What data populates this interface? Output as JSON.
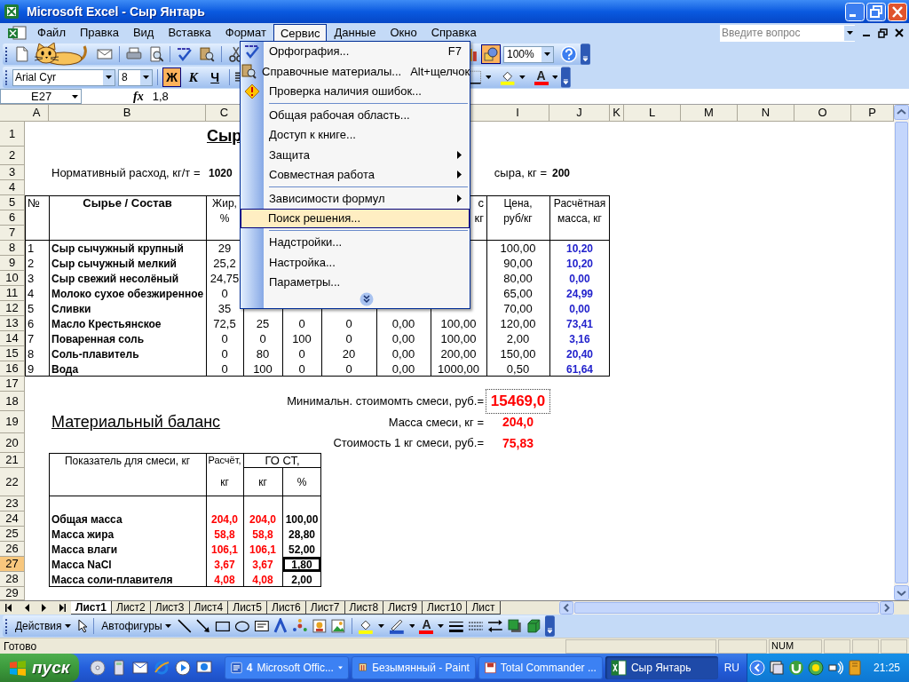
{
  "window": {
    "title": "Microsoft Excel - Сыр Янтарь"
  },
  "menu_bar": {
    "items": [
      {
        "label": "Файл",
        "selected": false
      },
      {
        "label": "Правка",
        "selected": false
      },
      {
        "label": "Вид",
        "selected": false
      },
      {
        "label": "Вставка",
        "selected": false
      },
      {
        "label": "Формат",
        "selected": false
      },
      {
        "label": "Сервис",
        "selected": true
      },
      {
        "label": "Данные",
        "selected": false
      },
      {
        "label": "Окно",
        "selected": false
      },
      {
        "label": "Справка",
        "selected": false
      }
    ],
    "help_placeholder": "Введите вопрос"
  },
  "standard_toolbar": {
    "zoom": "100%",
    "drawing_toggle": true
  },
  "formatting_toolbar": {
    "font": "Arial Cyr",
    "size": "8",
    "styles": [
      {
        "label": "Ж",
        "on": true
      },
      {
        "label": "К",
        "on": false
      },
      {
        "label": "Ч",
        "on": false
      }
    ],
    "font_color": "A"
  },
  "formula_bar": {
    "name_box": "E27",
    "function_label": "fx",
    "formula": "1,8"
  },
  "sheet": {
    "columns": [
      {
        "label": "A"
      },
      {
        "label": "B"
      },
      {
        "label": "C"
      },
      {
        "label": "I"
      },
      {
        "label": "J"
      },
      {
        "label": "K"
      },
      {
        "label": "L"
      },
      {
        "label": "M"
      },
      {
        "label": "N"
      },
      {
        "label": "O"
      },
      {
        "label": "P"
      }
    ],
    "rows": [
      {
        "number": "1",
        "selected": false,
        "cells": {
          "C": {
            "kind": "title",
            "text": "Сыр"
          }
        }
      },
      {
        "number": "2",
        "selected": false
      },
      {
        "number": "3",
        "selected": false,
        "cells": {
          "B": {
            "kind": "label",
            "text": "Нормативный расход, кг/т ="
          },
          "C": {
            "kind": "bold",
            "text": "1020"
          },
          "I": {
            "kind": "label-right",
            "text": "сыра, кг ="
          },
          "J": {
            "kind": "bold",
            "text": "200"
          }
        }
      },
      {
        "number": "4",
        "selected": false
      },
      {
        "number": "5",
        "selected": false,
        "cells": {
          "A": {
            "kind": "label",
            "text": "№"
          },
          "B": {
            "kind": "header-bold",
            "text": "Сырье / Состав"
          },
          "C": {
            "kind": "header",
            "text": "Жир,"
          },
          "H": {
            "kind": "label-right",
            "text": "с"
          },
          "I": {
            "kind": "header",
            "text": "Цена,"
          },
          "J": {
            "kind": "header",
            "text": "Расчётная"
          }
        }
      },
      {
        "number": "6",
        "selected": false,
        "cells": {
          "C": {
            "kind": "header",
            "text": "%"
          },
          "H": {
            "kind": "label-right",
            "text": "кг"
          },
          "I": {
            "kind": "header",
            "text": "руб/кг"
          },
          "J": {
            "kind": "header",
            "text": "масса, кг"
          }
        }
      },
      {
        "number": "7",
        "selected": false
      },
      {
        "number": "8",
        "selected": false,
        "cells": {
          "A": {
            "kind": "label",
            "text": "1"
          },
          "B": {
            "kind": "bold",
            "text": "Сыр сычужный крупный"
          },
          "C": {
            "kind": "number",
            "text": "29"
          },
          "I": {
            "kind": "number",
            "text": "100,00"
          },
          "J": {
            "kind": "blue",
            "text": "10,20"
          }
        }
      },
      {
        "number": "9",
        "selected": false,
        "cells": {
          "A": {
            "kind": "label",
            "text": "2"
          },
          "B": {
            "kind": "bold",
            "text": "Сыр сычужный мелкий"
          },
          "C": {
            "kind": "number",
            "text": "25,2"
          },
          "I": {
            "kind": "number",
            "text": "90,00"
          },
          "J": {
            "kind": "blue",
            "text": "10,20"
          }
        }
      },
      {
        "number": "10",
        "selected": false,
        "cells": {
          "A": {
            "kind": "label",
            "text": "3"
          },
          "B": {
            "kind": "bold",
            "text": "Сыр свежий несолёный"
          },
          "C": {
            "kind": "number",
            "text": "24,75"
          },
          "I": {
            "kind": "number",
            "text": "80,00"
          },
          "J": {
            "kind": "blue",
            "text": "0,00"
          }
        }
      },
      {
        "number": "11",
        "selected": false,
        "cells": {
          "A": {
            "kind": "label",
            "text": "4"
          },
          "B": {
            "kind": "bold",
            "text": "Молоко сухое обезжиренное"
          },
          "C": {
            "kind": "number",
            "text": "0"
          },
          "I": {
            "kind": "number",
            "text": "65,00"
          },
          "J": {
            "kind": "blue",
            "text": "24,99"
          }
        }
      },
      {
        "number": "12",
        "selected": false,
        "cells": {
          "A": {
            "kind": "label",
            "text": "5"
          },
          "B": {
            "kind": "bold",
            "text": "Сливки"
          },
          "C": {
            "kind": "number",
            "text": "35"
          },
          "I": {
            "kind": "number",
            "text": "70,00"
          },
          "J": {
            "kind": "blue",
            "text": "0,00"
          }
        }
      },
      {
        "number": "13",
        "selected": false,
        "cells": {
          "A": {
            "kind": "label",
            "text": "6"
          },
          "B": {
            "kind": "bold",
            "text": "Масло Крестьянское"
          },
          "C": {
            "kind": "number",
            "text": "72,5"
          },
          "D": {
            "kind": "number",
            "text": "25"
          },
          "E": {
            "kind": "number",
            "text": "0"
          },
          "F": {
            "kind": "number",
            "text": "0"
          },
          "G": {
            "kind": "number",
            "text": "0,00"
          },
          "H": {
            "kind": "number",
            "text": "100,00"
          },
          "I": {
            "kind": "number",
            "text": "120,00"
          },
          "J": {
            "kind": "blue",
            "text": "73,41"
          }
        }
      },
      {
        "number": "14",
        "selected": false,
        "cells": {
          "A": {
            "kind": "label",
            "text": "7"
          },
          "B": {
            "kind": "bold",
            "text": "Поваренная соль"
          },
          "C": {
            "kind": "number",
            "text": "0"
          },
          "D": {
            "kind": "number",
            "text": "0"
          },
          "E": {
            "kind": "number",
            "text": "100"
          },
          "F": {
            "kind": "number",
            "text": "0"
          },
          "G": {
            "kind": "number",
            "text": "0,00"
          },
          "H": {
            "kind": "number",
            "text": "100,00"
          },
          "I": {
            "kind": "number",
            "text": "2,00"
          },
          "J": {
            "kind": "blue",
            "text": "3,16"
          }
        }
      },
      {
        "number": "15",
        "selected": false,
        "cells": {
          "A": {
            "kind": "label",
            "text": "8"
          },
          "B": {
            "kind": "bold",
            "text": "Соль-плавитель"
          },
          "C": {
            "kind": "number",
            "text": "0"
          },
          "D": {
            "kind": "number",
            "text": "80"
          },
          "E": {
            "kind": "number",
            "text": "0"
          },
          "F": {
            "kind": "number",
            "text": "20"
          },
          "G": {
            "kind": "number",
            "text": "0,00"
          },
          "H": {
            "kind": "number",
            "text": "200,00"
          },
          "I": {
            "kind": "number",
            "text": "150,00"
          },
          "J": {
            "kind": "blue",
            "text": "20,40"
          }
        }
      },
      {
        "number": "16",
        "selected": false,
        "cells": {
          "A": {
            "kind": "label",
            "text": "9"
          },
          "B": {
            "kind": "bold",
            "text": "Вода"
          },
          "C": {
            "kind": "number",
            "text": "0"
          },
          "D": {
            "kind": "number",
            "text": "100"
          },
          "E": {
            "kind": "number",
            "text": "0"
          },
          "F": {
            "kind": "number",
            "text": "0"
          },
          "G": {
            "kind": "number",
            "text": "0,00"
          },
          "H": {
            "kind": "number",
            "text": "1000,00"
          },
          "I": {
            "kind": "number",
            "text": "0,50"
          },
          "J": {
            "kind": "blue",
            "text": "61,64"
          }
        }
      },
      {
        "number": "17",
        "selected": false
      },
      {
        "number": "18",
        "selected": false,
        "cells": {
          "H": {
            "kind": "label-right",
            "text": "Минимальн. стоимомть смеси, руб.="
          },
          "I": {
            "kind": "total",
            "text": "15469,0"
          }
        }
      },
      {
        "number": "19",
        "selected": false,
        "cells": {
          "B": {
            "kind": "heading",
            "text": "Материальный баланс"
          },
          "H": {
            "kind": "label-right",
            "text": "Масса смеси, кг ="
          },
          "I": {
            "kind": "red-large",
            "text": "204,0"
          }
        }
      },
      {
        "number": "20",
        "selected": false,
        "cells": {
          "H": {
            "kind": "label-right",
            "text": "Стоимость 1 кг смеси, руб.="
          },
          "I": {
            "kind": "red-large",
            "text": "75,83"
          }
        }
      },
      {
        "number": "21",
        "selected": false,
        "cells": {
          "B": {
            "kind": "header",
            "text": "Показатель для смеси, кг"
          },
          "C": {
            "kind": "header-small",
            "text": "Расчёт,"
          },
          "D": {
            "kind": "header-merged",
            "text": "ГО СТ,"
          }
        }
      },
      {
        "number": "22",
        "selected": false,
        "cells": {
          "C": {
            "kind": "header",
            "text": "кг"
          },
          "D": {
            "kind": "header",
            "text": "кг"
          },
          "E": {
            "kind": "header",
            "text": "%"
          }
        }
      },
      {
        "number": "23",
        "selected": false
      },
      {
        "number": "24",
        "selected": false,
        "cells": {
          "B": {
            "kind": "bold",
            "text": "Общая масса"
          },
          "C": {
            "kind": "red",
            "text": "204,0"
          },
          "D": {
            "kind": "red",
            "text": "204,0"
          },
          "E": {
            "kind": "bold-center",
            "text": "100,00"
          }
        }
      },
      {
        "number": "25",
        "selected": false,
        "cells": {
          "B": {
            "kind": "bold",
            "text": "Масса жира"
          },
          "C": {
            "kind": "red",
            "text": "58,8"
          },
          "D": {
            "kind": "red",
            "text": "58,8"
          },
          "E": {
            "kind": "bold-center",
            "text": "28,80"
          }
        }
      },
      {
        "number": "26",
        "selected": false,
        "cells": {
          "B": {
            "kind": "bold",
            "text": "Масса влаги"
          },
          "C": {
            "kind": "red",
            "text": "106,1"
          },
          "D": {
            "kind": "red",
            "text": "106,1"
          },
          "E": {
            "kind": "bold-center",
            "text": "52,00"
          }
        }
      },
      {
        "number": "27",
        "selected": true,
        "cells": {
          "B": {
            "kind": "bold",
            "text": "Масса NaCl"
          },
          "C": {
            "kind": "red",
            "text": "3,67"
          },
          "D": {
            "kind": "red",
            "text": "3,67"
          },
          "E": {
            "kind": "active",
            "text": "1,80"
          }
        }
      },
      {
        "number": "28",
        "selected": false,
        "cells": {
          "B": {
            "kind": "bold",
            "text": "Масса соли-плавителя"
          },
          "C": {
            "kind": "red",
            "text": "4,08"
          },
          "D": {
            "kind": "red",
            "text": "4,08"
          },
          "E": {
            "kind": "bold-center",
            "text": "2,00"
          }
        }
      },
      {
        "number": "29",
        "selected": false
      }
    ]
  },
  "tools_menu": {
    "items": [
      {
        "label": "Орфография...",
        "shortcut": "F7",
        "submenu": false,
        "separator_before": false,
        "selected": false
      },
      {
        "label": "Справочные материалы...",
        "shortcut": "Alt+щелчок",
        "submenu": false,
        "separator_before": false,
        "selected": false
      },
      {
        "label": "Проверка наличия ошибок...",
        "submenu": false,
        "separator_before": false,
        "selected": false
      },
      {
        "label": "Общая рабочая область...",
        "submenu": false,
        "separator_before": true,
        "selected": false
      },
      {
        "label": "Доступ к книге...",
        "submenu": false,
        "separator_before": false,
        "selected": false
      },
      {
        "label": "Защита",
        "submenu": true,
        "separator_before": false,
        "selected": false
      },
      {
        "label": "Совместная работа",
        "submenu": true,
        "separator_before": false,
        "selected": false
      },
      {
        "label": "Зависимости формул",
        "submenu": true,
        "separator_before": true,
        "selected": false
      },
      {
        "label": "Поиск решения...",
        "submenu": false,
        "separator_before": false,
        "selected": true
      },
      {
        "label": "Надстройки...",
        "submenu": false,
        "separator_before": true,
        "selected": false
      },
      {
        "label": "Настройка...",
        "submenu": false,
        "separator_before": false,
        "selected": false
      },
      {
        "label": "Параметры...",
        "submenu": false,
        "separator_before": false,
        "selected": false
      }
    ]
  },
  "sheet_tabs": [
    {
      "label": "Лист1",
      "selected": true
    },
    {
      "label": "Лист2",
      "selected": false
    },
    {
      "label": "Лист3",
      "selected": false
    },
    {
      "label": "Лист4",
      "selected": false
    },
    {
      "label": "Лист5",
      "selected": false
    },
    {
      "label": "Лист6",
      "selected": false
    },
    {
      "label": "Лист7",
      "selected": false
    },
    {
      "label": "Лист8",
      "selected": false
    },
    {
      "label": "Лист9",
      "selected": false
    },
    {
      "label": "Лист10",
      "selected": false
    },
    {
      "label": "Лист",
      "selected": false
    }
  ],
  "drawing_toolbar": {
    "actions": "Действия",
    "autoshapes": "Автофигуры",
    "font_color": "A"
  },
  "status_bar": {
    "status": "Готово",
    "indicators": [
      "NUM"
    ]
  },
  "taskbar": {
    "start": "пуск",
    "tasks": [
      {
        "count": "4",
        "label": "Microsoft Offic...",
        "selected": false
      },
      {
        "label": "Безымянный - Paint",
        "selected": false
      },
      {
        "label": "Total Commander ...",
        "selected": false
      },
      {
        "label": "Сыр Янтарь",
        "selected": true
      }
    ],
    "language": "RU",
    "clock": "21:25"
  }
}
